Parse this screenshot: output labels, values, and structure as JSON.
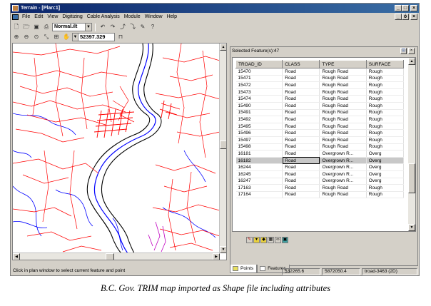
{
  "window": {
    "title": "Terrain - [Plan:1]",
    "controls": [
      "_",
      "□",
      "×"
    ]
  },
  "menubar": {
    "items": [
      "File",
      "Edit",
      "View",
      "Digitizing",
      "Cable Analysis",
      "Module",
      "Window",
      "Help"
    ],
    "child_controls": [
      "_",
      "ó",
      "×"
    ]
  },
  "toolbar1": {
    "style_value": "Normal.ilt"
  },
  "toolbar2": {
    "scale_value": "52397.329"
  },
  "map": {
    "colors": {
      "roads": "#ff0000",
      "streams": "#0000ff",
      "river_bank": "#000000",
      "other": "#c000c0"
    }
  },
  "features": {
    "title": "Selected Feature(s):47",
    "columns": [
      "TROAD_ID",
      "CLASS",
      "TYPE",
      "SURFACE"
    ],
    "rows": [
      [
        "15470",
        "Road",
        "Rough Road",
        "Rough"
      ],
      [
        "15471",
        "Road",
        "Rough Road",
        "Rough"
      ],
      [
        "15472",
        "Road",
        "Rough Road",
        "Rough"
      ],
      [
        "15473",
        "Road",
        "Rough Road",
        "Rough"
      ],
      [
        "15474",
        "Road",
        "Rough Road",
        "Rough"
      ],
      [
        "15490",
        "Road",
        "Rough Road",
        "Rough"
      ],
      [
        "15491",
        "Road",
        "Rough Road",
        "Rough"
      ],
      [
        "15492",
        "Road",
        "Rough Road",
        "Rough"
      ],
      [
        "15495",
        "Road",
        "Rough Road",
        "Rough"
      ],
      [
        "15496",
        "Road",
        "Rough Road",
        "Rough"
      ],
      [
        "15497",
        "Road",
        "Rough Road",
        "Rough"
      ],
      [
        "15498",
        "Road",
        "Rough Road",
        "Rough"
      ],
      [
        "16181",
        "Road",
        "Overgrown R...",
        "Overg"
      ],
      [
        "16182",
        "Road",
        "Overgrown R...",
        "Overg"
      ],
      [
        "16244",
        "Road",
        "Overgrown R...",
        "Overg"
      ],
      [
        "16245",
        "Road",
        "Overgrown R...",
        "Overg"
      ],
      [
        "16247",
        "Road",
        "Overgrown R...",
        "Overg"
      ],
      [
        "17163",
        "Road",
        "Rough Road",
        "Rough"
      ],
      [
        "17164",
        "Road",
        "Rough Road",
        "Rough"
      ]
    ],
    "selected_row": 13
  },
  "tabs": [
    "Points",
    "Features"
  ],
  "status": {
    "message": "Click in plan window to select current feature and point",
    "x": "532265.6",
    "y": "5872050.4",
    "feature": "troad-3463 (2D)"
  },
  "caption": "B.C. Gov. TRIM map imported as Shape file including attributes"
}
